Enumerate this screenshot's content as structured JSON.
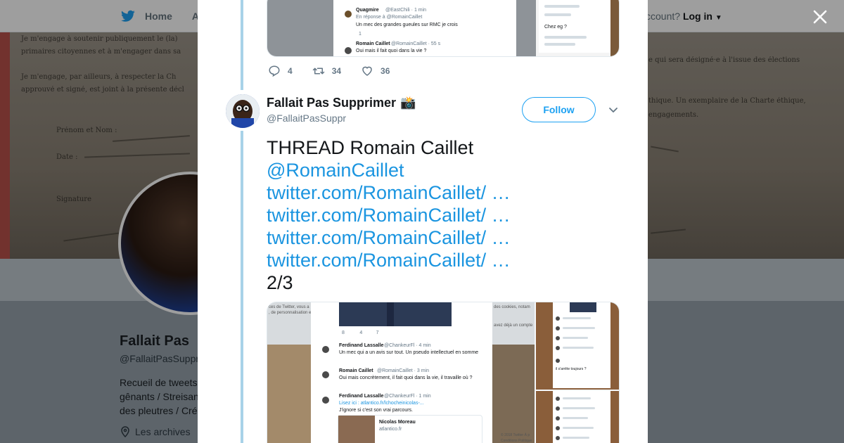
{
  "background": {
    "nav": {
      "home_label": "Home",
      "about_label": "Abo",
      "account_text": "ccount?",
      "login_label": "Log in"
    },
    "banner_text": [
      "Je m'engage à soutenir publiquement le (la)",
      "primaires citoyennes et à m'engager dans sa",
      "Je m'engage, par ailleurs, à respecter la Ch",
      "approuvé et signé, est joint à la présente décl",
      "Prénom et Nom :",
      "Date :",
      "Signature",
      "e qui sera désigné·e à l'issue des élections",
      "thique. Un exemplaire de la Charte éthique,",
      "engagements."
    ],
    "profile": {
      "name": "Fallait Pas",
      "handle": "@FallaitPasSuppr",
      "bio": "Recueil de tweets\ngênants / Streisan\ndes pleutres / Cré",
      "location": "Les archives"
    }
  },
  "previous_tweet": {
    "reply_count": "4",
    "retweet_count": "34",
    "like_count": "36",
    "media_snippets": {
      "first_name": "Quagmire",
      "first_handle": "@EastChili · 1 min",
      "reply_to": "En réponse à @RomainCaillet",
      "first_text": "Un mec des grandes gueules sur RMC je crois",
      "second_name": "Romain Caillet",
      "second_handle": "@RomainCaillet · 55 s",
      "second_text": "Oui mais il fait quoi dans la vie ?",
      "side_text": "Chez eg ?"
    }
  },
  "tweet": {
    "author_name": "Fallait Pas Supprimer",
    "author_emoji": "📸",
    "author_handle": "@FallaitPasSuppr",
    "follow_label": "Follow",
    "lines": {
      "heading": "THREAD Romain Caillet",
      "mention": "@RomainCaillet",
      "link1": "twitter.com/RomainCaillet/ …",
      "link2": "twitter.com/RomainCaillet/ …",
      "link3": "twitter.com/RomainCaillet/ …",
      "link4": "twitter.com/RomainCaillet/ …",
      "count": "2/3"
    },
    "media_snippets": {
      "header_left": "ces de Twitter, vous a",
      "header_left2": ", de personnalisation et",
      "header_right": "des cookies, notam",
      "header_right2": "avez déjà un compte",
      "stat_reply": "8",
      "stat_rt": "4",
      "stat_like": "7",
      "p1_name": "Ferdinand Lassalle",
      "p1_handle": "@ChankeurFl · 4 min",
      "p1_text": "Un mec qui a un avis sur tout. Un pseudo intellectuel en somme",
      "p2_name": "Romain Caillet",
      "p2_handle": "@RomainCaillet · 3 min",
      "p2_text": "Oui mais concrètement, il fait quoi dans la vie, il travaille où ?",
      "p3_name": "Ferdinand Lassalle",
      "p3_handle": "@ChankeurFl · 1 min",
      "p3_text1": "Lisez ici : atlantico.fr/lchocheinicolas-...",
      "p3_text2": "J'ignore si c'est son vrai parcours.",
      "card_name": "Nicolas Moreau",
      "card_domain": "atlantico.fr",
      "footer": "© 2018 Twitter  À p",
      "footer2": "Conditions  Politique",
      "side_text": "il s'arrête toujours ?"
    }
  },
  "colors": {
    "accent": "#1da1f2",
    "link": "#1b95e0",
    "thread_line": "#a8d2e8",
    "muted": "#657786"
  }
}
